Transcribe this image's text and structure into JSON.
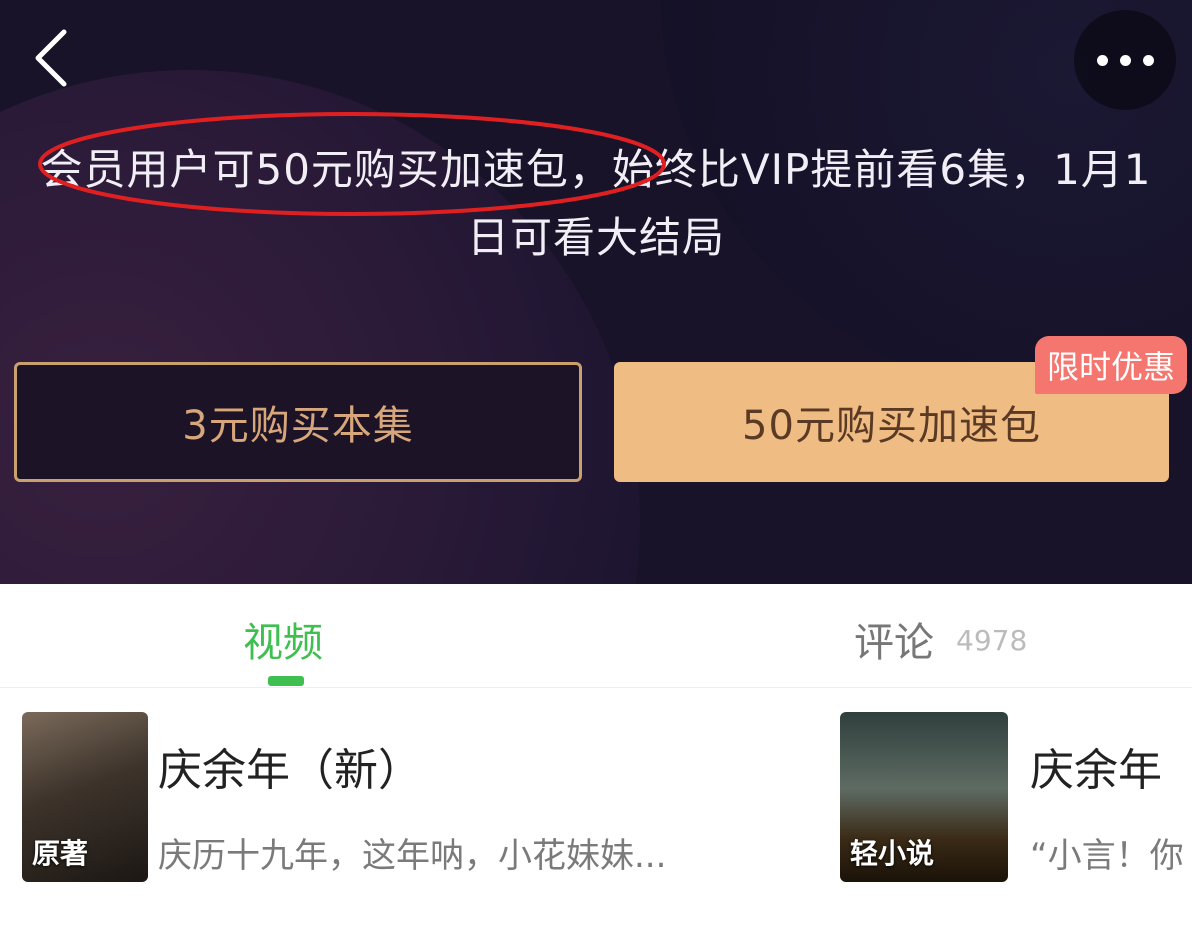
{
  "header": {
    "back_icon": "chevron-left-icon",
    "more_icon": "more-horizontal-icon"
  },
  "promo": {
    "text": "会员用户可50元购买加速包，始终比VIP提前看6集，1月1日可看大结局"
  },
  "purchase": {
    "single_label": "3元购买本集",
    "pack_label": "50元购买加速包",
    "badge_label": "限时优惠"
  },
  "tabs": {
    "video_label": "视频",
    "comments_label": "评论",
    "comments_count": "4978"
  },
  "cards": [
    {
      "cover_label": "原著",
      "title": "庆余年（新）",
      "subtitle": "庆历十九年，这年呐，小花妹妹..."
    },
    {
      "cover_label": "轻小说",
      "title": "庆余年",
      "subtitle": "“小言！你"
    }
  ],
  "colors": {
    "accent_green": "#3fbf4f",
    "gold_button": "#efbc83",
    "badge_red": "#f4766f",
    "annotation_red": "#e02020"
  }
}
